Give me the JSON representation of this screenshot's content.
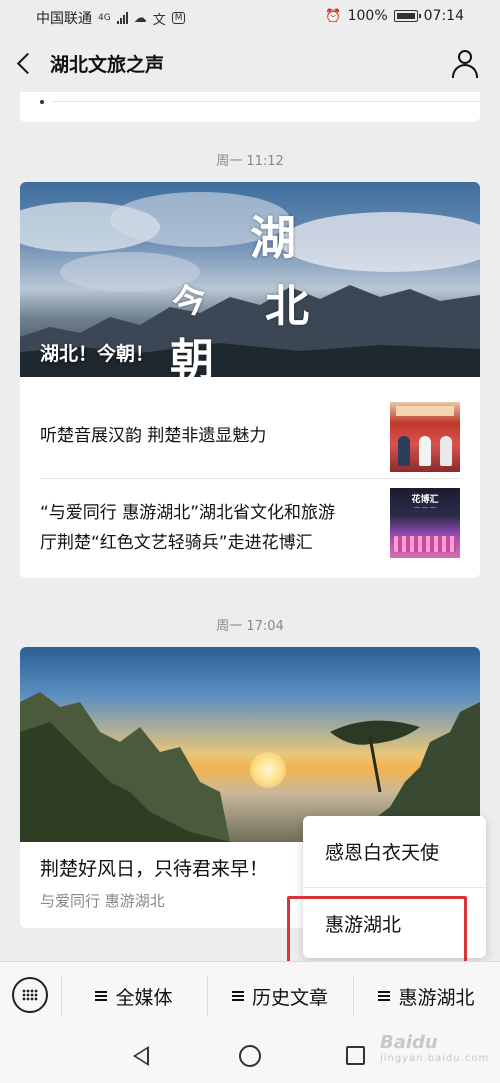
{
  "status_bar": {
    "carrier": "中国联通",
    "network": "4G",
    "battery": "100%",
    "time": "07:14"
  },
  "header": {
    "title": "湖北文旅之声"
  },
  "messages": [
    {
      "timestamp": "周一 11:12",
      "cover_title": "湖北！今朝！",
      "cover_calligraphy": [
        "湖",
        "北",
        "今",
        "朝"
      ],
      "items": [
        {
          "title": "听楚音展汉韵  荆楚非遗显魅力"
        },
        {
          "title_line1": "“与爱同行 惠游湖北”湖北省文化和旅游",
          "title_line2": "厅荆楚“红色文艺轻骑兵”走进花博汇",
          "thumb_label": "花博汇"
        }
      ]
    },
    {
      "timestamp": "周一 17:04",
      "title": "荆楚好风日，只待君来早！",
      "subtitle": "与爱同行 惠游湖北"
    }
  ],
  "popup_menu": {
    "items": [
      "感恩白衣天使",
      "惠游湖北"
    ]
  },
  "bottom_menu": {
    "items": [
      "全媒体",
      "历史文章",
      "惠游湖北"
    ]
  },
  "watermark": {
    "text": "Baidu",
    "sub": "jingyan.baidu.com"
  }
}
